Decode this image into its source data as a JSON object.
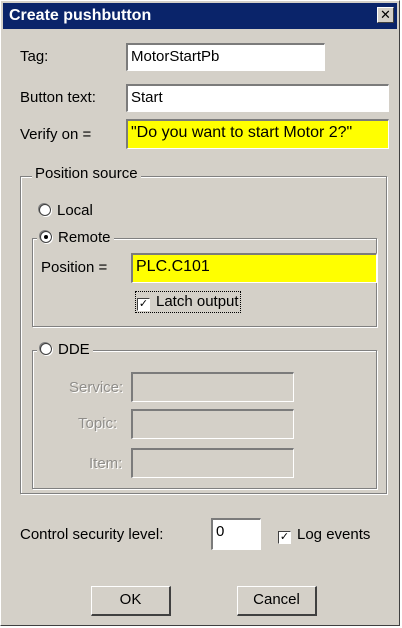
{
  "window": {
    "title": "Create pushbutton",
    "close_glyph": "✕"
  },
  "fields": {
    "tag": {
      "label": "Tag:",
      "value": "MotorStartPb"
    },
    "button_text": {
      "label": "Button text:",
      "value": "Start"
    },
    "verify_on": {
      "label": "Verify on =",
      "value": "\"Do you want to start Motor 2?\""
    }
  },
  "position_source": {
    "legend": "Position source",
    "local": {
      "label": "Local",
      "selected": false
    },
    "remote": {
      "label": "Remote",
      "selected": true,
      "position_label": "Position =",
      "position_value": "PLC.C101",
      "latch_label": "Latch output",
      "latch_checked": true
    },
    "dde": {
      "label": "DDE",
      "selected": false,
      "service_label": "Service:",
      "service_value": "",
      "topic_label": "Topic:",
      "topic_value": "",
      "item_label": "Item:",
      "item_value": ""
    }
  },
  "security": {
    "label": "Control security level:",
    "value": "0",
    "log_events_label": "Log events",
    "log_events_checked": true
  },
  "buttons": {
    "ok": "OK",
    "cancel": "Cancel"
  },
  "icons": {
    "check_glyph": "✓"
  },
  "colors": {
    "title_bar": "#0a246a",
    "highlight_field": "#ffff00",
    "dialog_bg": "#d4d0c8"
  }
}
